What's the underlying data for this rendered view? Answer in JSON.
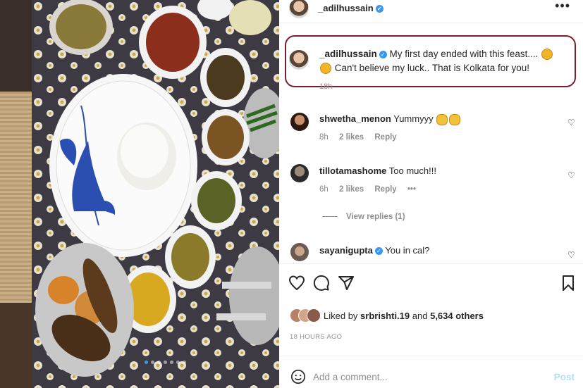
{
  "post": {
    "author": "_adilhussain",
    "more_icon": "more-horizontal-icon",
    "caption": {
      "username": "_adilhussain",
      "text_part1": "My first day ended with this feast....",
      "text_part2": "Can't believe my luck.. That is Kolkata for you!",
      "time": "18h"
    }
  },
  "comments": [
    {
      "username": "shwetha_menon",
      "verified": false,
      "text": "Yummyyy",
      "emoji": "clapping-hands",
      "time": "8h",
      "likes": "2 likes",
      "reply": "Reply"
    },
    {
      "username": "tillotamashome",
      "verified": false,
      "text": "Too much!!!",
      "time": "6h",
      "likes": "2 likes",
      "reply": "Reply",
      "more": "•••"
    },
    {
      "username": "sayanigupta",
      "verified": true,
      "text": "You in cal?"
    }
  ],
  "view_replies": "View replies (1)",
  "actions": {
    "like_icon": "heart-icon",
    "comment_icon": "comment-icon",
    "share_icon": "share-icon",
    "save_icon": "bookmark-icon"
  },
  "likes": {
    "liked_by_prefix": "Liked by",
    "liked_by_user": "srbrishti.19",
    "and_text": "and",
    "others": "5,634 others"
  },
  "timestamp": "18 HOURS AGO",
  "add_comment": {
    "placeholder": "Add a comment...",
    "post_label": "Post",
    "emoji_icon": "smile-icon"
  },
  "carousel": {
    "next_icon": "chevron-right-icon",
    "slides": 7,
    "active_slide": 1
  },
  "colors": {
    "accent": "#3897f0",
    "highlight_border": "#7a1f2b",
    "muted": "#8e8e8e"
  }
}
